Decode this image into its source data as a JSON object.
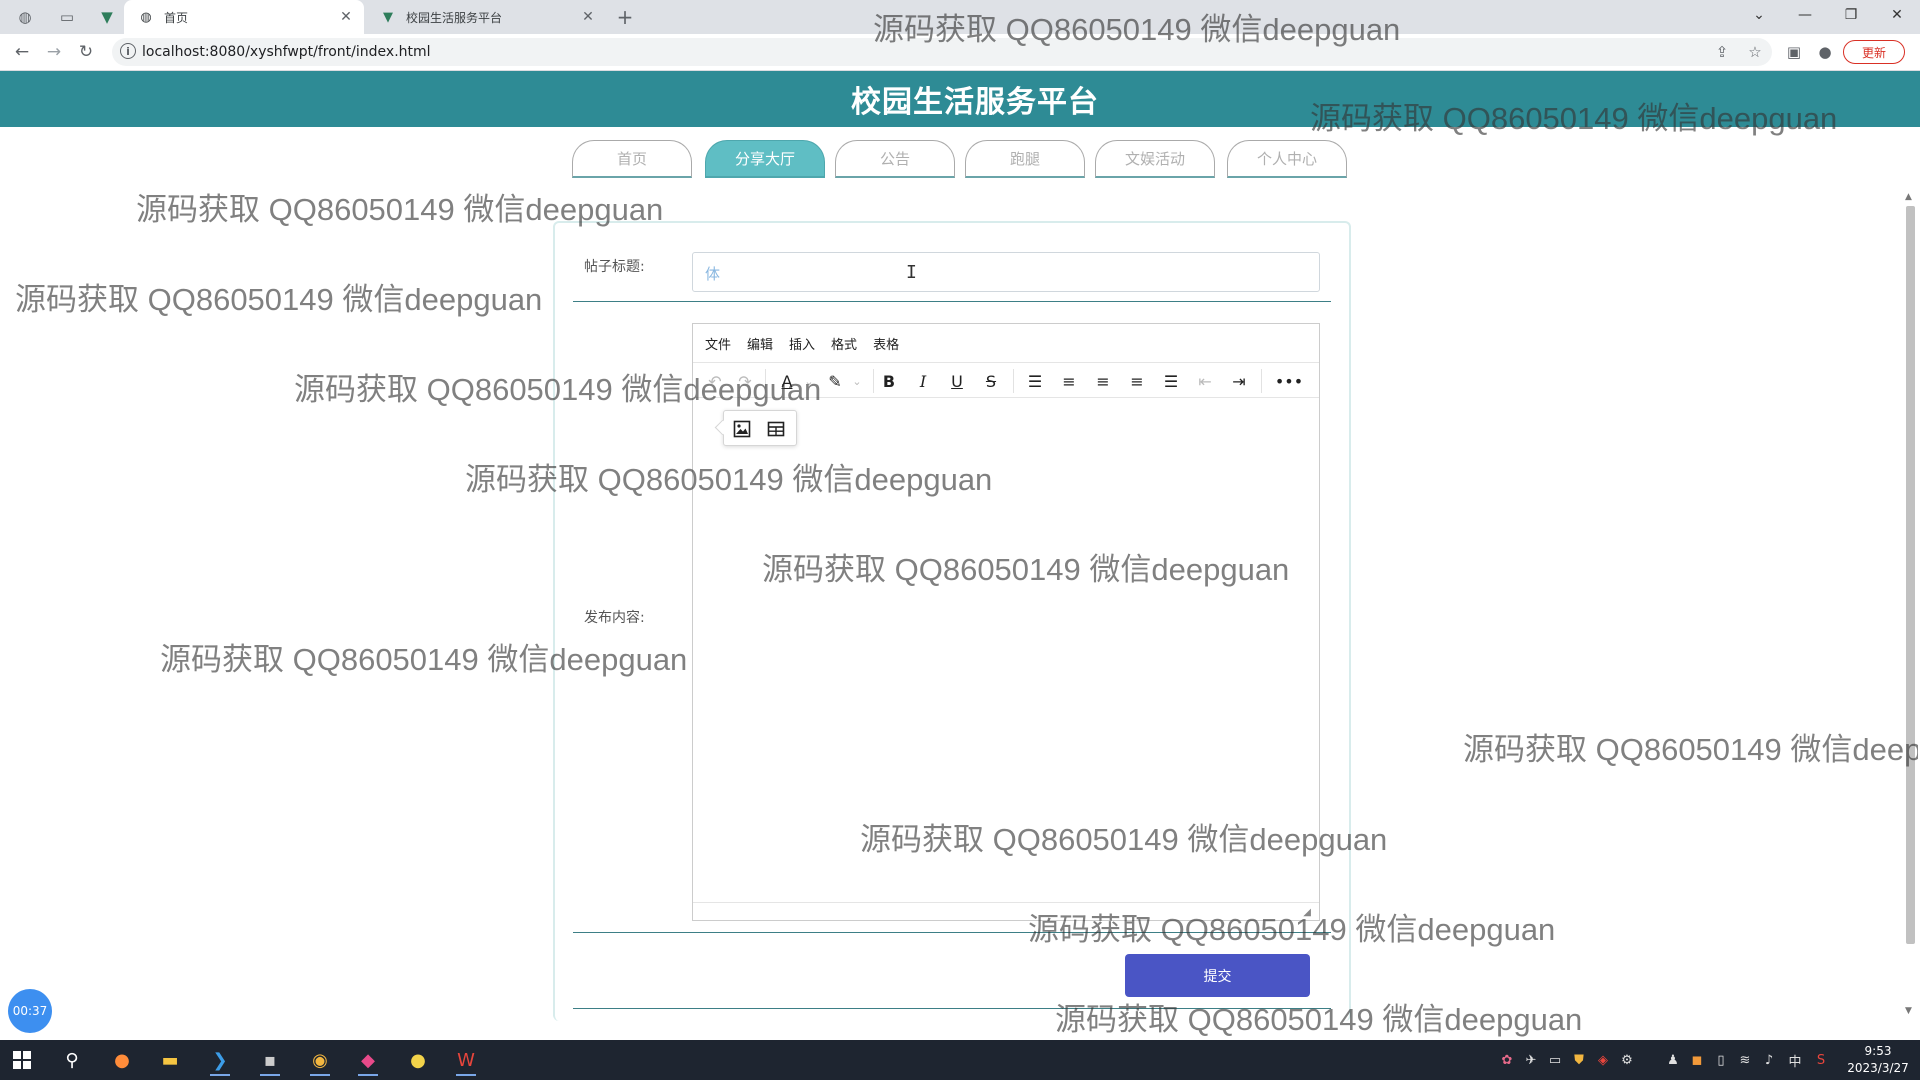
{
  "browser": {
    "tabs": [
      {
        "title": "首页",
        "active": true
      },
      {
        "title": "校园生活服务平台",
        "active": false
      }
    ],
    "address": "localhost:8080/xyshfwpt/front/index.html",
    "update_label": "更新"
  },
  "site": {
    "title": "校园生活服务平台",
    "nav": [
      {
        "label": "首页",
        "active": false
      },
      {
        "label": "分享大厅",
        "active": true
      },
      {
        "label": "公告",
        "active": false
      },
      {
        "label": "跑腿",
        "active": false
      },
      {
        "label": "文娱活动",
        "active": false
      },
      {
        "label": "个人中心",
        "active": false
      }
    ]
  },
  "form": {
    "title_label": "帖子标题:",
    "title_value": "体",
    "content_label": "发布内容:",
    "submit_label": "提交"
  },
  "editor": {
    "menus": [
      "文件",
      "编辑",
      "插入",
      "格式",
      "表格"
    ]
  },
  "overlay": {
    "timer": "00:37"
  },
  "watermark_text": "源码获取 QQ86050149 微信deepguan",
  "taskbar": {
    "time": "9:53",
    "date": "2023/3/27",
    "ime": "中"
  },
  "colors": {
    "header": "#2e8b95",
    "nav_active": "#5fbec4",
    "submit": "#4a55c5"
  }
}
